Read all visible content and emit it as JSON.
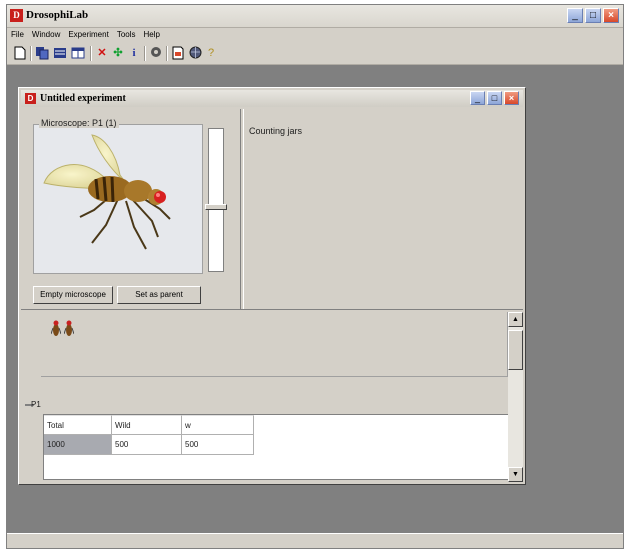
{
  "app": {
    "title": "DrosophiLab",
    "icon_letter": "D",
    "controls": {
      "minimize": "_",
      "maximize": "□",
      "close": "×"
    }
  },
  "menu": [
    "File",
    "Window",
    "Experiment",
    "Tools",
    "Help"
  ],
  "toolbar": {
    "icons": [
      "new-document-icon",
      "copy-flies-icon",
      "list-icon",
      "grid-icon",
      "delete-icon",
      "move-icon",
      "info-icon",
      "settings-icon",
      "report-icon",
      "globe-icon",
      "help-icon"
    ]
  },
  "child_window": {
    "title": "Untitled experiment",
    "icon_letter": "D",
    "microscope_label": "Microscope: P1 (1)",
    "empty_button": "Empty microscope",
    "set_parent_button": "Set as parent",
    "notes_text": "Counting jars",
    "section_label": "P1",
    "table": {
      "headers": [
        "Total",
        "Wild",
        "w"
      ],
      "rows": [
        [
          "1000",
          "500",
          "500"
        ]
      ]
    }
  },
  "colors": {
    "accent_red": "#c8201c",
    "window_button_blue": "#8ea6d8",
    "workspace_gray": "#808080"
  }
}
